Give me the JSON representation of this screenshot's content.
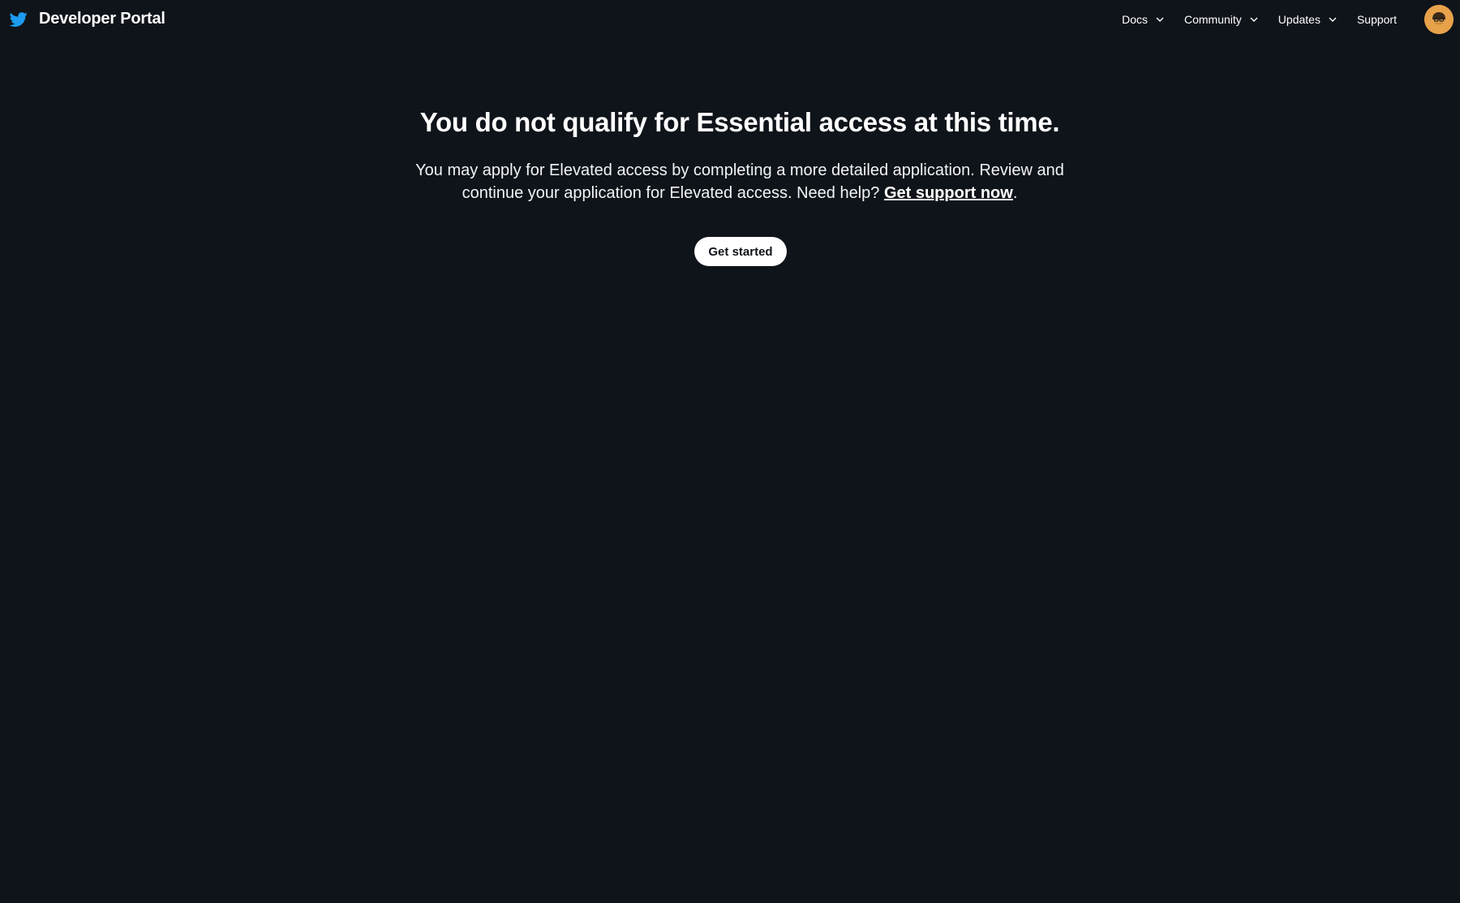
{
  "header": {
    "logo_icon": "twitter-bird-icon",
    "title": "Developer Portal",
    "nav": [
      {
        "label": "Docs",
        "has_dropdown": true
      },
      {
        "label": "Community",
        "has_dropdown": true
      },
      {
        "label": "Updates",
        "has_dropdown": true
      },
      {
        "label": "Support",
        "has_dropdown": false
      }
    ],
    "avatar_icon": "user-avatar-icon"
  },
  "main": {
    "headline": "You do not qualify for Essential access at this time.",
    "description_text": "You may apply for Elevated access by completing a more detailed application. Review and continue your application for Elevated access. Need help? ",
    "support_link": "Get support now",
    "description_end": ".",
    "cta_button": "Get started"
  },
  "colors": {
    "background": "#0f141a",
    "brand_blue": "#1d9bf0",
    "avatar_bg": "#e7a24a",
    "button_bg": "#ffffff"
  }
}
